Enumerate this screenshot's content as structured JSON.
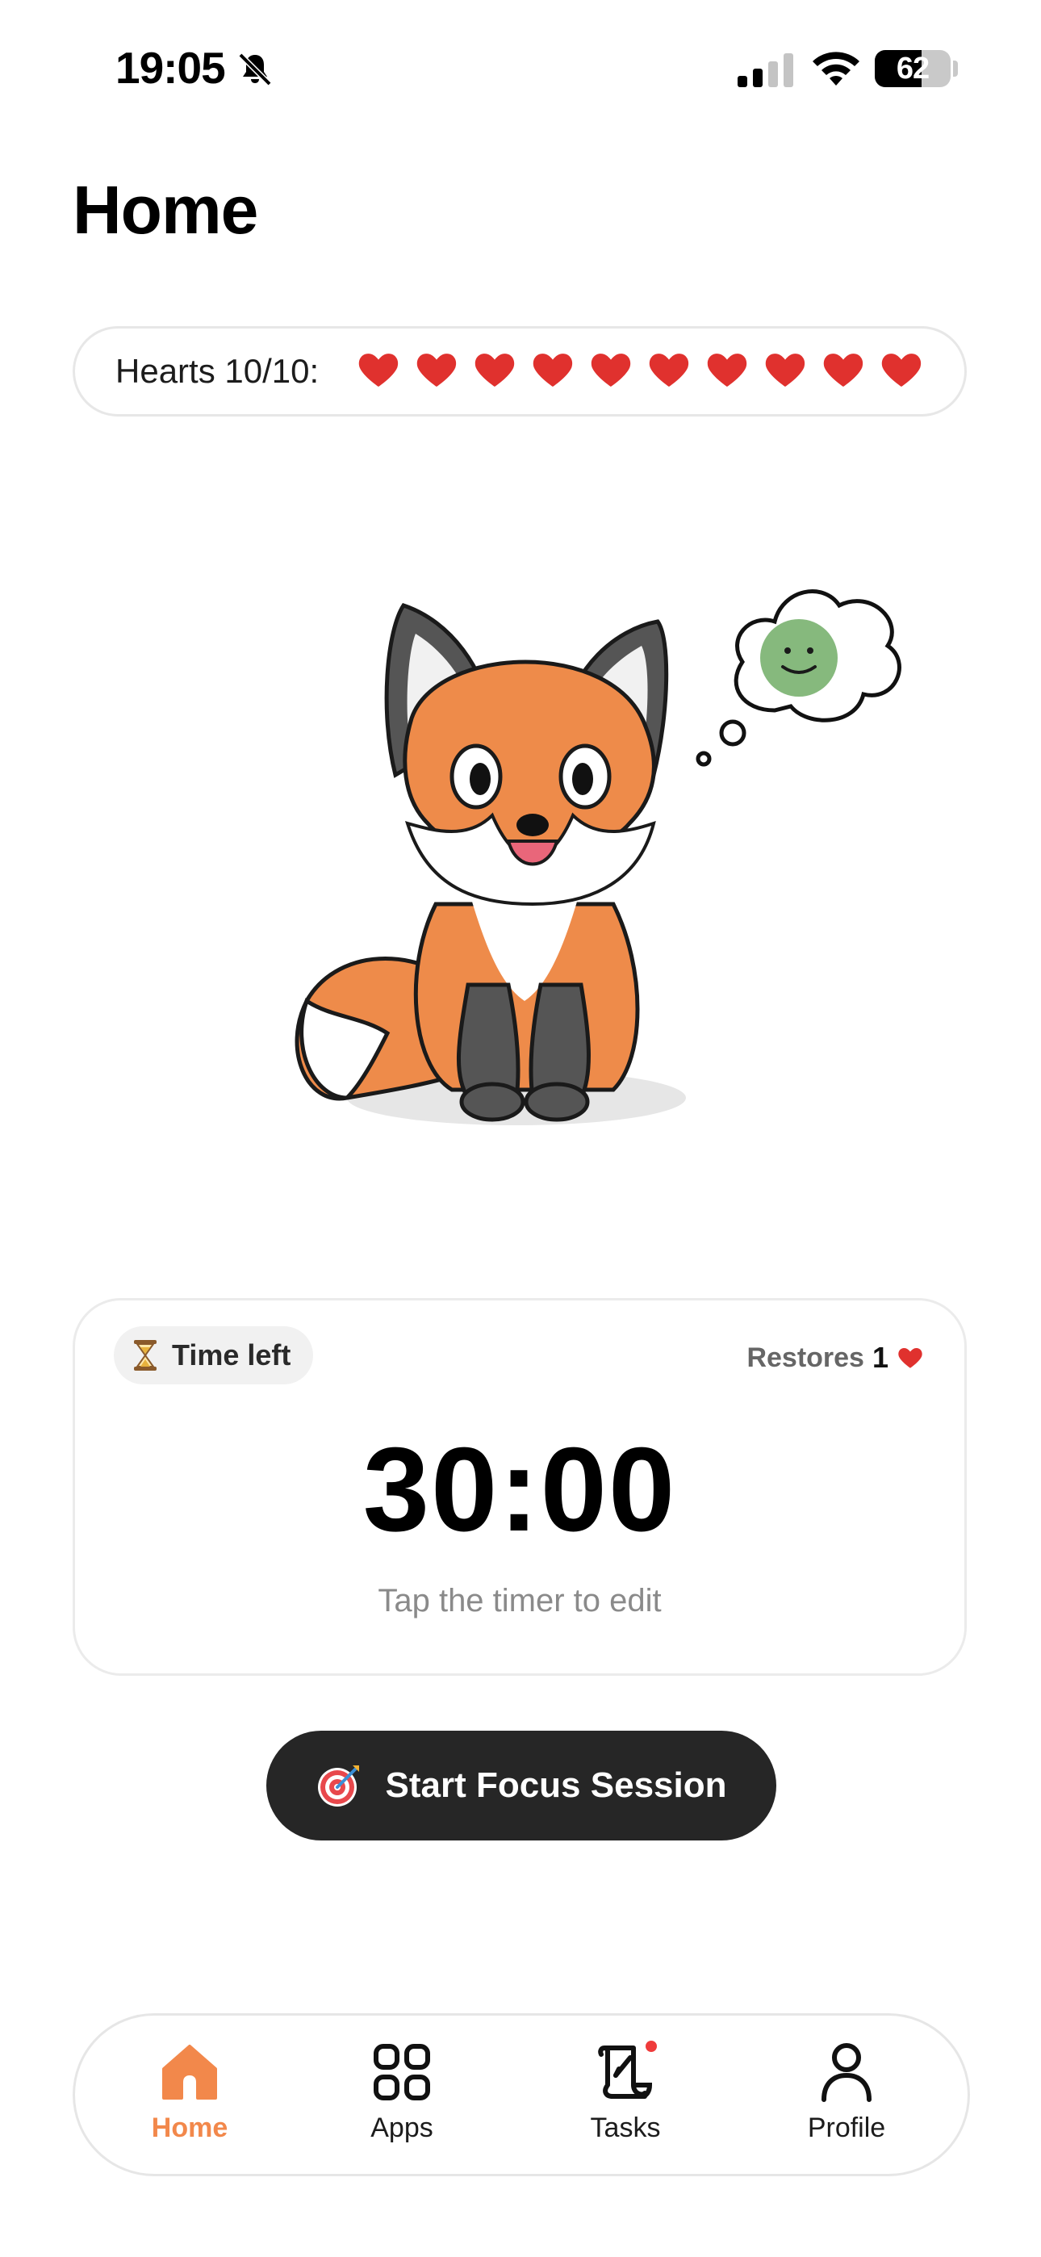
{
  "status_bar": {
    "time": "19:05",
    "battery_percent": 62,
    "battery_label": "62"
  },
  "page_title": "Home",
  "hearts": {
    "label": "Hearts 10/10:",
    "current": 10,
    "max": 10,
    "color": "#e0312e"
  },
  "timer_card": {
    "chip_label": "Time left",
    "restores_label": "Restores",
    "restores_count": "1",
    "time": "30:00",
    "hint": "Tap the timer to edit"
  },
  "start_button": {
    "label": "Start Focus Session",
    "icon": "target-icon"
  },
  "tab_bar": {
    "active_color": "#f2884b",
    "tabs": [
      {
        "label": "Home",
        "icon": "home-icon",
        "active": true
      },
      {
        "label": "Apps",
        "icon": "apps-grid-icon",
        "active": false
      },
      {
        "label": "Tasks",
        "icon": "tasks-scroll-icon",
        "active": false,
        "badge": true
      },
      {
        "label": "Profile",
        "icon": "profile-icon",
        "active": false
      }
    ]
  },
  "mascot": {
    "icon": "fox-mascot-icon",
    "thought_icon": "smiley-thought-icon",
    "mood_color": "#86b97d"
  }
}
